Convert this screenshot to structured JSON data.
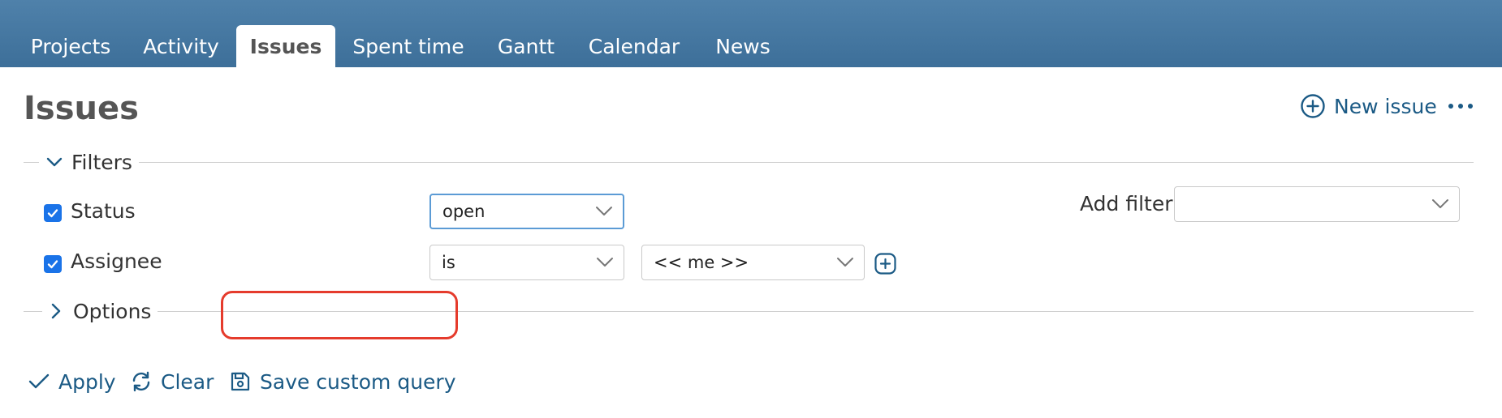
{
  "tabs": [
    {
      "label": "Projects",
      "active": false
    },
    {
      "label": "Activity",
      "active": false
    },
    {
      "label": "Issues",
      "active": true
    },
    {
      "label": "Spent time",
      "active": false
    },
    {
      "label": "Gantt",
      "active": false
    },
    {
      "label": "Calendar",
      "active": false
    },
    {
      "label": "News",
      "active": false
    }
  ],
  "page": {
    "title": "Issues",
    "new_issue_label": "New issue"
  },
  "filters": {
    "legend": "Filters",
    "rows": [
      {
        "label": "Status",
        "checked": true,
        "operator": "open"
      },
      {
        "label": "Assignee",
        "checked": true,
        "operator": "is",
        "value": "<< me >>"
      }
    ],
    "add_filter_label": "Add filter",
    "add_filter_value": ""
  },
  "options": {
    "legend": "Options"
  },
  "actions": {
    "apply": "Apply",
    "clear": "Clear",
    "save": "Save custom query"
  },
  "colors": {
    "header": "#4a7aa3",
    "link": "#1b5a85",
    "checkbox": "#1a73e8",
    "highlight": "#e53b2c"
  }
}
